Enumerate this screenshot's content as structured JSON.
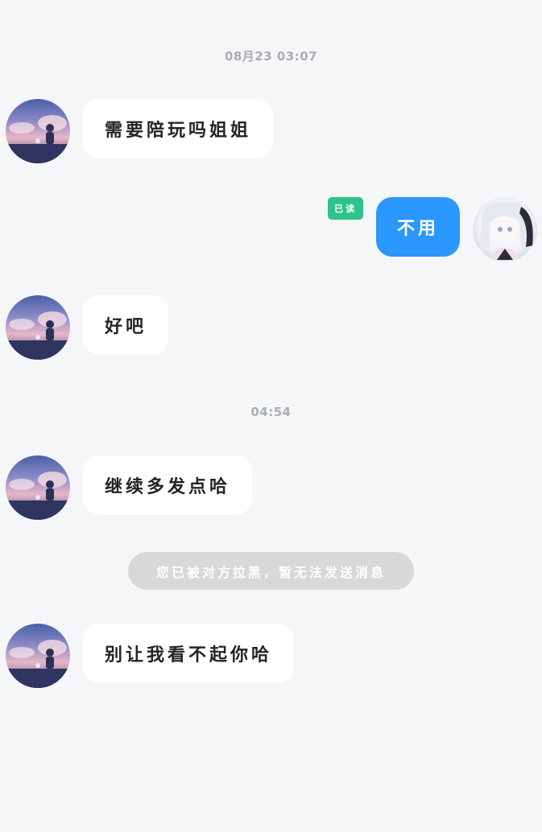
{
  "timestamps": {
    "first": "08月23  03:07",
    "second": "04:54"
  },
  "messages": [
    {
      "direction": "incoming",
      "text": "需要陪玩吗姐姐"
    },
    {
      "direction": "outgoing",
      "text": "不用",
      "status": "已读"
    },
    {
      "direction": "incoming",
      "text": "好吧"
    },
    {
      "direction": "incoming",
      "text": "继续多发点哈"
    },
    {
      "direction": "incoming",
      "text": "别让我看不起你哈"
    }
  ],
  "system_notice": "您已被对方拉黑，暂无法发送消息",
  "colors": {
    "background": "#f5f6f8",
    "incoming_bubble": "#ffffff",
    "outgoing_bubble": "#2a98ff",
    "read_badge": "#2fc38b",
    "notice_pill": "#d7d8da",
    "timestamp": "#a9adb4"
  }
}
